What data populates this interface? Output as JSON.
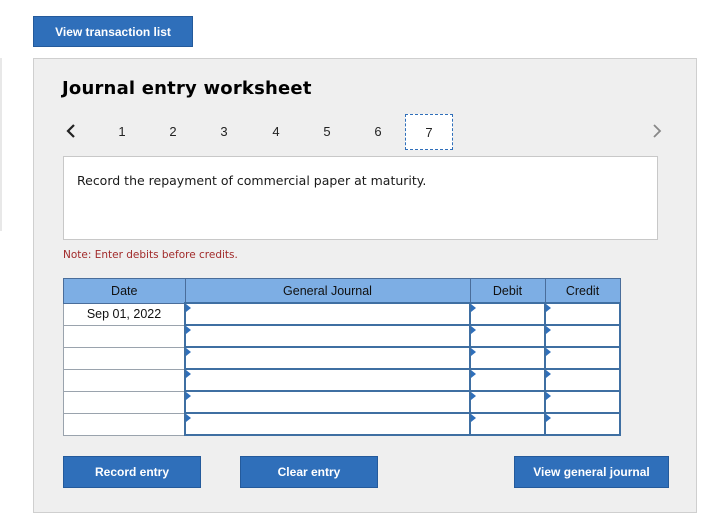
{
  "top": {
    "view_transaction_list": "View transaction list"
  },
  "worksheet": {
    "title": "Journal entry worksheet",
    "pages": [
      "1",
      "2",
      "3",
      "4",
      "5",
      "6",
      "7"
    ],
    "active_page": "7",
    "instruction": "Record the repayment of commercial paper at maturity.",
    "note": "Note: Enter debits before credits."
  },
  "table": {
    "headers": {
      "date": "Date",
      "general_journal": "General Journal",
      "debit": "Debit",
      "credit": "Credit"
    },
    "rows": [
      {
        "date": "Sep 01, 2022",
        "account": "",
        "debit": "",
        "credit": ""
      },
      {
        "date": "",
        "account": "",
        "debit": "",
        "credit": ""
      },
      {
        "date": "",
        "account": "",
        "debit": "",
        "credit": ""
      },
      {
        "date": "",
        "account": "",
        "debit": "",
        "credit": ""
      },
      {
        "date": "",
        "account": "",
        "debit": "",
        "credit": ""
      },
      {
        "date": "",
        "account": "",
        "debit": "",
        "credit": ""
      }
    ]
  },
  "buttons": {
    "record_entry": "Record entry",
    "clear_entry": "Clear entry",
    "view_general_journal": "View general journal"
  },
  "icons": {
    "prev": "chevron-left-icon",
    "next": "chevron-right-icon"
  }
}
